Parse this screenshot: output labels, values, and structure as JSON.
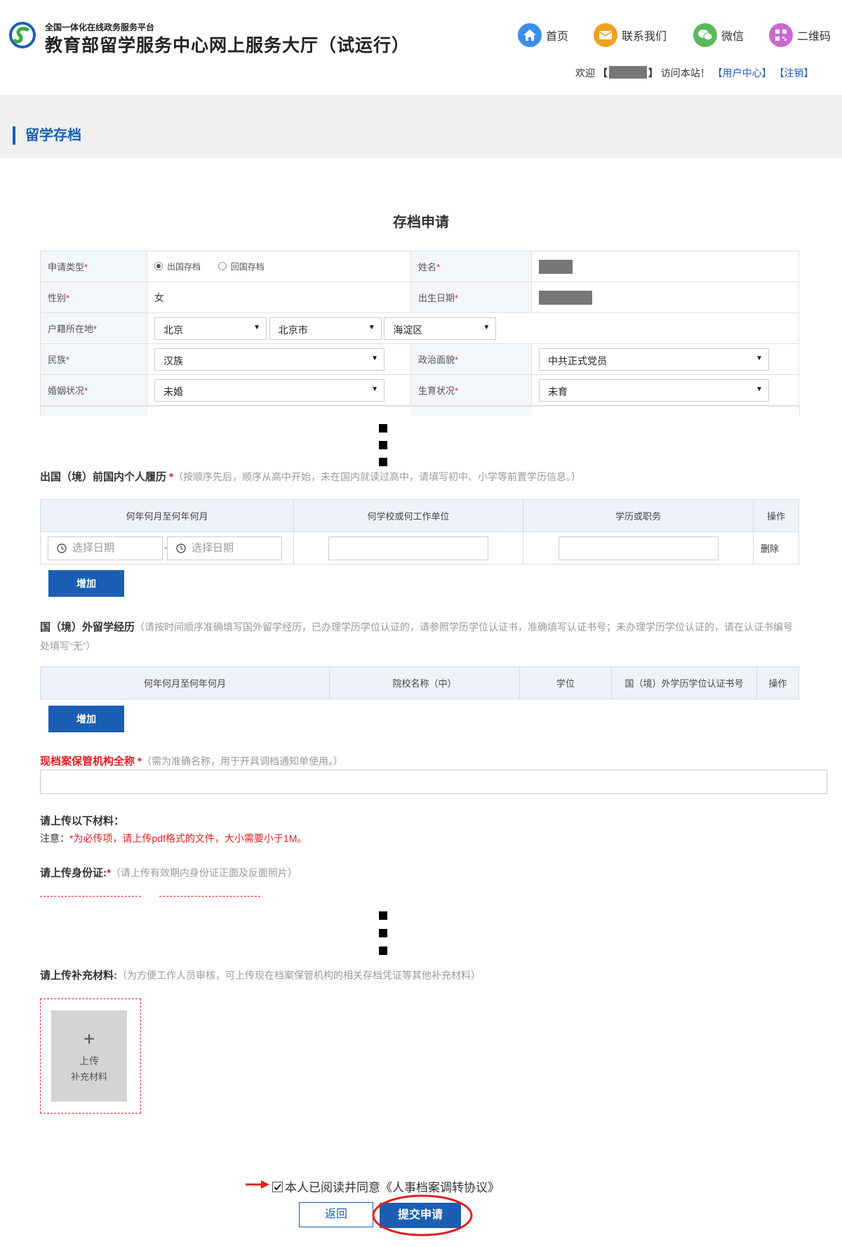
{
  "header": {
    "platform": "全国一体化在线政务服务平台",
    "site_title": "教育部留学服务中心网上服务大厅（试运行）",
    "nav": [
      "首页",
      "联系我们",
      "微信",
      "二维码"
    ],
    "welcome_pre": "欢迎",
    "welcome_post": "访问本站！",
    "user_center": "【用户中心】",
    "logout": "【注销】",
    "colors": {
      "home": "#3d8ee8",
      "contact": "#f0a020",
      "wechat": "#5cb85c",
      "qrcode": "#c86ad1"
    }
  },
  "section_title": "留学存档",
  "form": {
    "title": "存档申请",
    "apply_type": {
      "label": "申请类型",
      "options": [
        "出国存档",
        "回国存档"
      ],
      "selected": "出国存档"
    },
    "name": {
      "label": "姓名"
    },
    "gender": {
      "label": "性别",
      "value": "女"
    },
    "birth": {
      "label": "出生日期"
    },
    "hukou": {
      "label": "户籍所在地",
      "province": "北京",
      "city": "北京市",
      "district": "海淀区"
    },
    "ethnicity": {
      "label": "民族",
      "value": "汉族"
    },
    "politics": {
      "label": "政治面貌",
      "value": "中共正式党员"
    },
    "marital": {
      "label": "婚姻状况",
      "value": "未婚"
    },
    "fertility": {
      "label": "生育状况",
      "value": "未育"
    }
  },
  "domestic": {
    "title": "出国（境）前国内个人履历",
    "hint": "（按顺序先后，顺序从高中开始，未在国内就读过高中，请填写初中、小学等前置学历信息。）",
    "columns": [
      "何年何月至何年何月",
      "何学校或何工作单位",
      "学历或职务",
      "操作"
    ],
    "date_placeholder": "选择日期",
    "delete": "删除",
    "add": "增加"
  },
  "abroad": {
    "title": "国（境）外留学经历",
    "hint": "（请按时间顺序准确填写国外留学经历，已办理学历学位认证的，请参照学历学位认证书，准确填写认证书号；未办理学历学位认证的，请在认证书编号处填写“无”）",
    "columns": [
      "何年何月至何年何月",
      "院校名称（中）",
      "学位",
      "国（境）外学历学位认证书号",
      "操作"
    ],
    "add": "增加"
  },
  "institution": {
    "title": "现档案保管机构全称",
    "hint": "（需为准确名称，用于开具调档通知单使用。）"
  },
  "materials": {
    "title": "请上传以下材料：",
    "note_label": "注意：",
    "note": "*为必传项，请上传pdf格式的文件，大小需要小于1M。",
    "id_title": "请上传身份证:",
    "id_hint": "（请上传有效期内身份证正面及反面照片）",
    "supp_title": "请上传补充材料:",
    "supp_hint": "（为方便工作人员审核，可上传现在档案保管机构的相关存档凭证等其他补充材料）",
    "upload_plus": "+",
    "upload_line1": "上传",
    "upload_line2": "补充材料"
  },
  "agreement": {
    "text": "本人已阅读并同意",
    "link": "《人事档案调转协议》",
    "checked": true
  },
  "actions": {
    "back": "返回",
    "submit": "提交申请"
  }
}
